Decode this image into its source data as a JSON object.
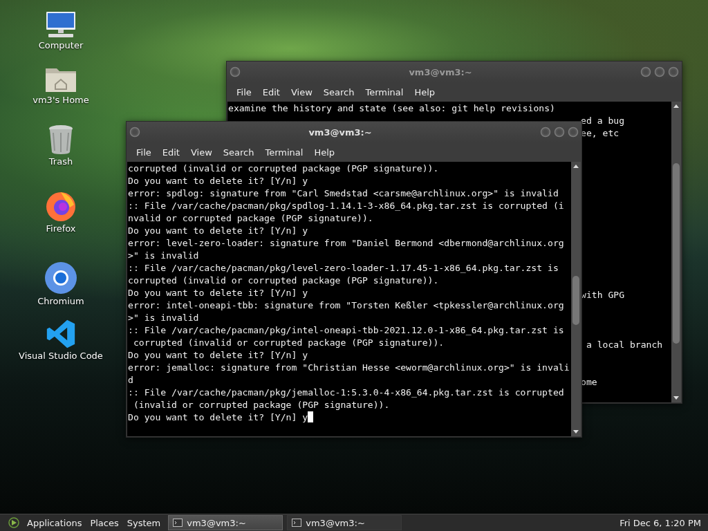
{
  "desktop_icons": [
    {
      "label": "Computer",
      "kind": "computer"
    },
    {
      "label": "vm3's Home",
      "kind": "home"
    },
    {
      "label": "Trash",
      "kind": "trash"
    },
    {
      "label": "Firefox",
      "kind": "firefox"
    },
    {
      "label": "Chromium",
      "kind": "chromium"
    },
    {
      "label": "Visual Studio Code",
      "kind": "vscode"
    }
  ],
  "windows": [
    {
      "title": "vm3@vm3:~",
      "menu": [
        "File",
        "Edit",
        "View",
        "Search",
        "Terminal",
        "Help"
      ],
      "lines": [
        "examine the history and state (see also: git help revisions)"
      ],
      "fragments": [
        "ed a bug",
        "ee, etc",
        "with GPG",
        " a local branch",
        "ome"
      ],
      "cursor": false
    },
    {
      "title": "vm3@vm3:~",
      "menu": [
        "File",
        "Edit",
        "View",
        "Search",
        "Terminal",
        "Help"
      ],
      "lines": [
        "corrupted (invalid or corrupted package (PGP signature)).",
        "Do you want to delete it? [Y/n] y",
        "error: spdlog: signature from \"Carl Smedstad <carsme@archlinux.org>\" is invalid",
        ":: File /var/cache/pacman/pkg/spdlog-1.14.1-3-x86_64.pkg.tar.zst is corrupted (i",
        "nvalid or corrupted package (PGP signature)).",
        "Do you want to delete it? [Y/n] y",
        "error: level-zero-loader: signature from \"Daniel Bermond <dbermond@archlinux.org",
        ">\" is invalid",
        ":: File /var/cache/pacman/pkg/level-zero-loader-1.17.45-1-x86_64.pkg.tar.zst is",
        "corrupted (invalid or corrupted package (PGP signature)).",
        "Do you want to delete it? [Y/n] y",
        "error: intel-oneapi-tbb: signature from \"Torsten Keßler <tpkessler@archlinux.org",
        ">\" is invalid",
        ":: File /var/cache/pacman/pkg/intel-oneapi-tbb-2021.12.0-1-x86_64.pkg.tar.zst is",
        " corrupted (invalid or corrupted package (PGP signature)).",
        "Do you want to delete it? [Y/n] y",
        "error: jemalloc: signature from \"Christian Hesse <eworm@archlinux.org>\" is invali",
        "d",
        ":: File /var/cache/pacman/pkg/jemalloc-1:5.3.0-4-x86_64.pkg.tar.zst is corrupted",
        " (invalid or corrupted package (PGP signature)).",
        "Do you want to delete it? [Y/n] y"
      ],
      "cursor": true
    }
  ],
  "taskbar": {
    "menus": [
      "Applications",
      "Places",
      "System"
    ],
    "tasks": [
      {
        "label": "vm3@vm3:~",
        "selected": true
      },
      {
        "label": "vm3@vm3:~",
        "selected": false
      }
    ],
    "clock": "Fri Dec 6, 1:20 PM"
  }
}
